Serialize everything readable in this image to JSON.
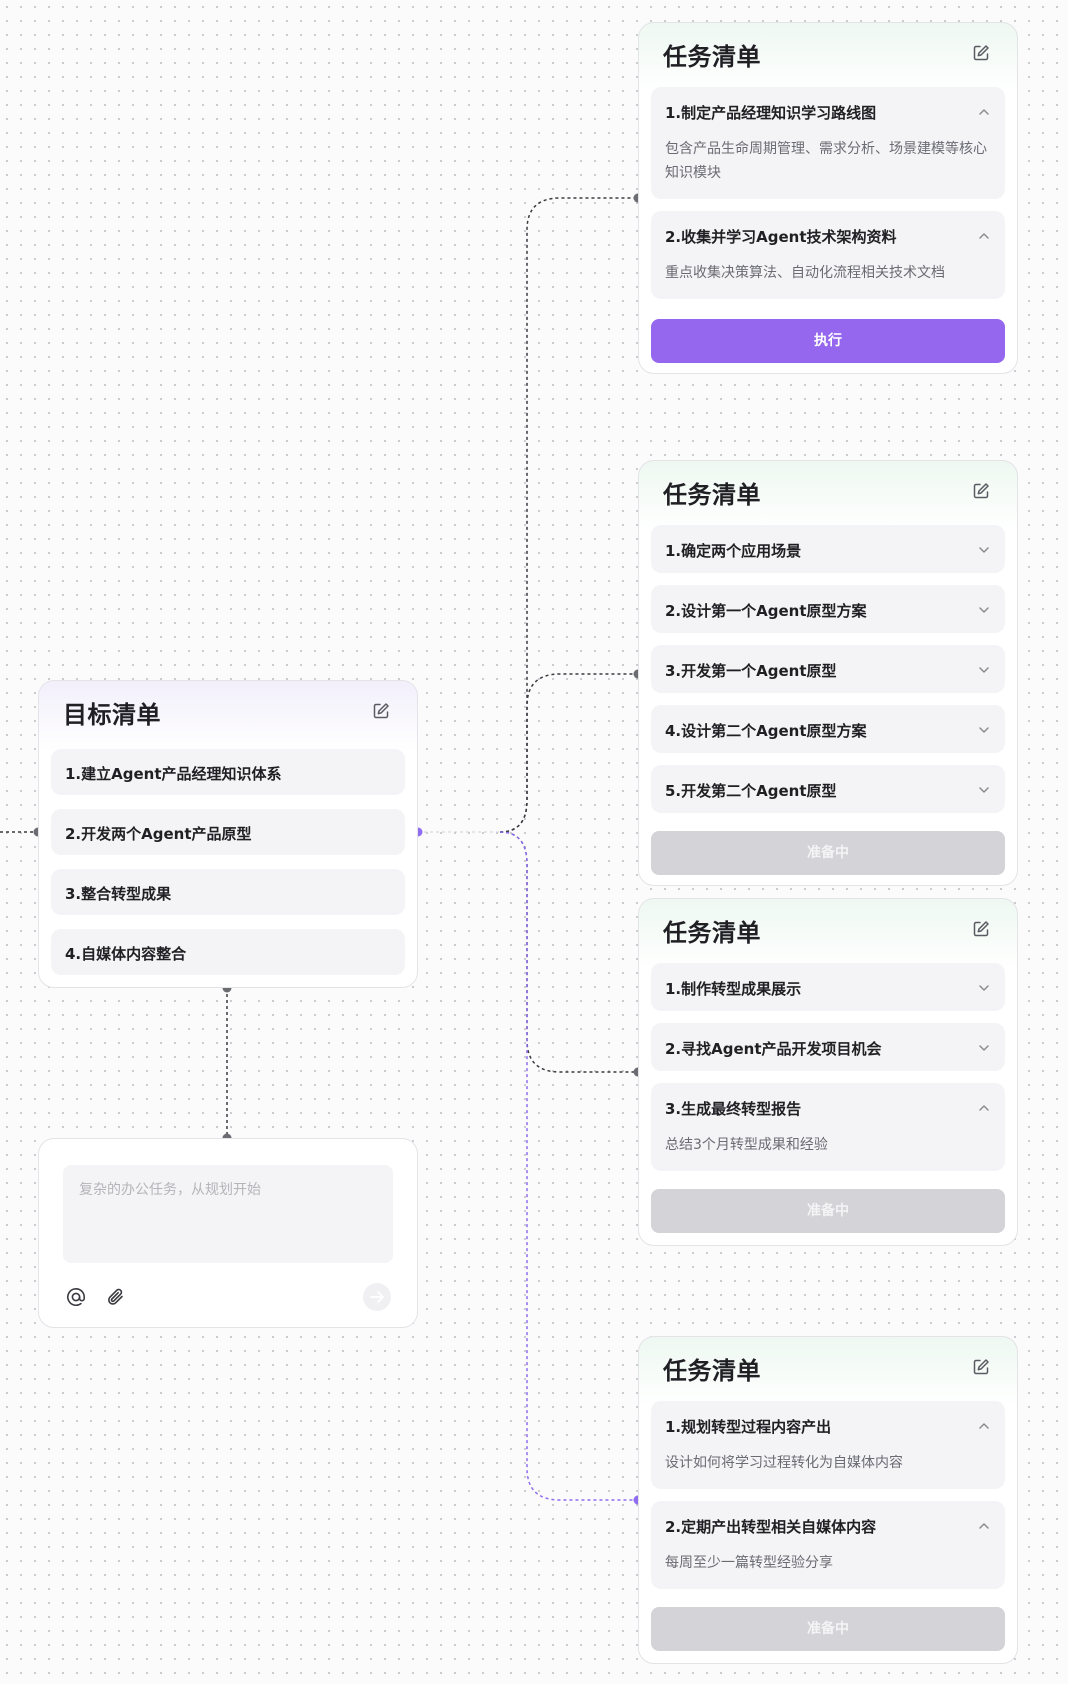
{
  "colors": {
    "accent": "#9567ee",
    "disabled": "#d3d3d8",
    "connector_dark": "#3a3a40",
    "connector_accent": "#8f6cf0"
  },
  "goal_card": {
    "title": "目标清单",
    "items": [
      "1.建立Agent产品经理知识体系",
      "2.开发两个Agent产品原型",
      "3.整合转型成果",
      "4.自媒体内容整合"
    ]
  },
  "input_box": {
    "placeholder": "复杂的办公任务，从规划开始",
    "icons": [
      "at-icon",
      "paperclip-icon",
      "send-icon"
    ]
  },
  "task_cards": [
    {
      "title": "任务清单",
      "items": [
        {
          "title": "1.制定产品经理知识学习路线图",
          "desc": "包含产品生命周期管理、需求分析、场景建模等核心知识模块",
          "expanded": true
        },
        {
          "title": "2.收集并学习Agent技术架构资料",
          "desc": "重点收集决策算法、自动化流程相关技术文档",
          "expanded": true
        }
      ],
      "button": "执行",
      "button_state": "active"
    },
    {
      "title": "任务清单",
      "items": [
        {
          "title": "1.确定两个应用场景",
          "expanded": false
        },
        {
          "title": "2.设计第一个Agent原型方案",
          "expanded": false
        },
        {
          "title": "3.开发第一个Agent原型",
          "expanded": false
        },
        {
          "title": "4.设计第二个Agent原型方案",
          "expanded": false
        },
        {
          "title": "5.开发第二个Agent原型",
          "expanded": false
        }
      ],
      "button": "准备中",
      "button_state": "disabled"
    },
    {
      "title": "任务清单",
      "items": [
        {
          "title": "1.制作转型成果展示",
          "expanded": false
        },
        {
          "title": "2.寻找Agent产品开发项目机会",
          "expanded": false
        },
        {
          "title": "3.生成最终转型报告",
          "desc": "总结3个月转型成果和经验",
          "expanded": true
        }
      ],
      "button": "准备中",
      "button_state": "disabled"
    },
    {
      "title": "任务清单",
      "items": [
        {
          "title": "1.规划转型过程内容产出",
          "desc": "设计如何将学习过程转化为自媒体内容",
          "expanded": true
        },
        {
          "title": "2.定期产出转型相关自媒体内容",
          "desc": "每周至少一篇转型经验分享",
          "expanded": true
        }
      ],
      "button": "准备中",
      "button_state": "disabled"
    }
  ]
}
